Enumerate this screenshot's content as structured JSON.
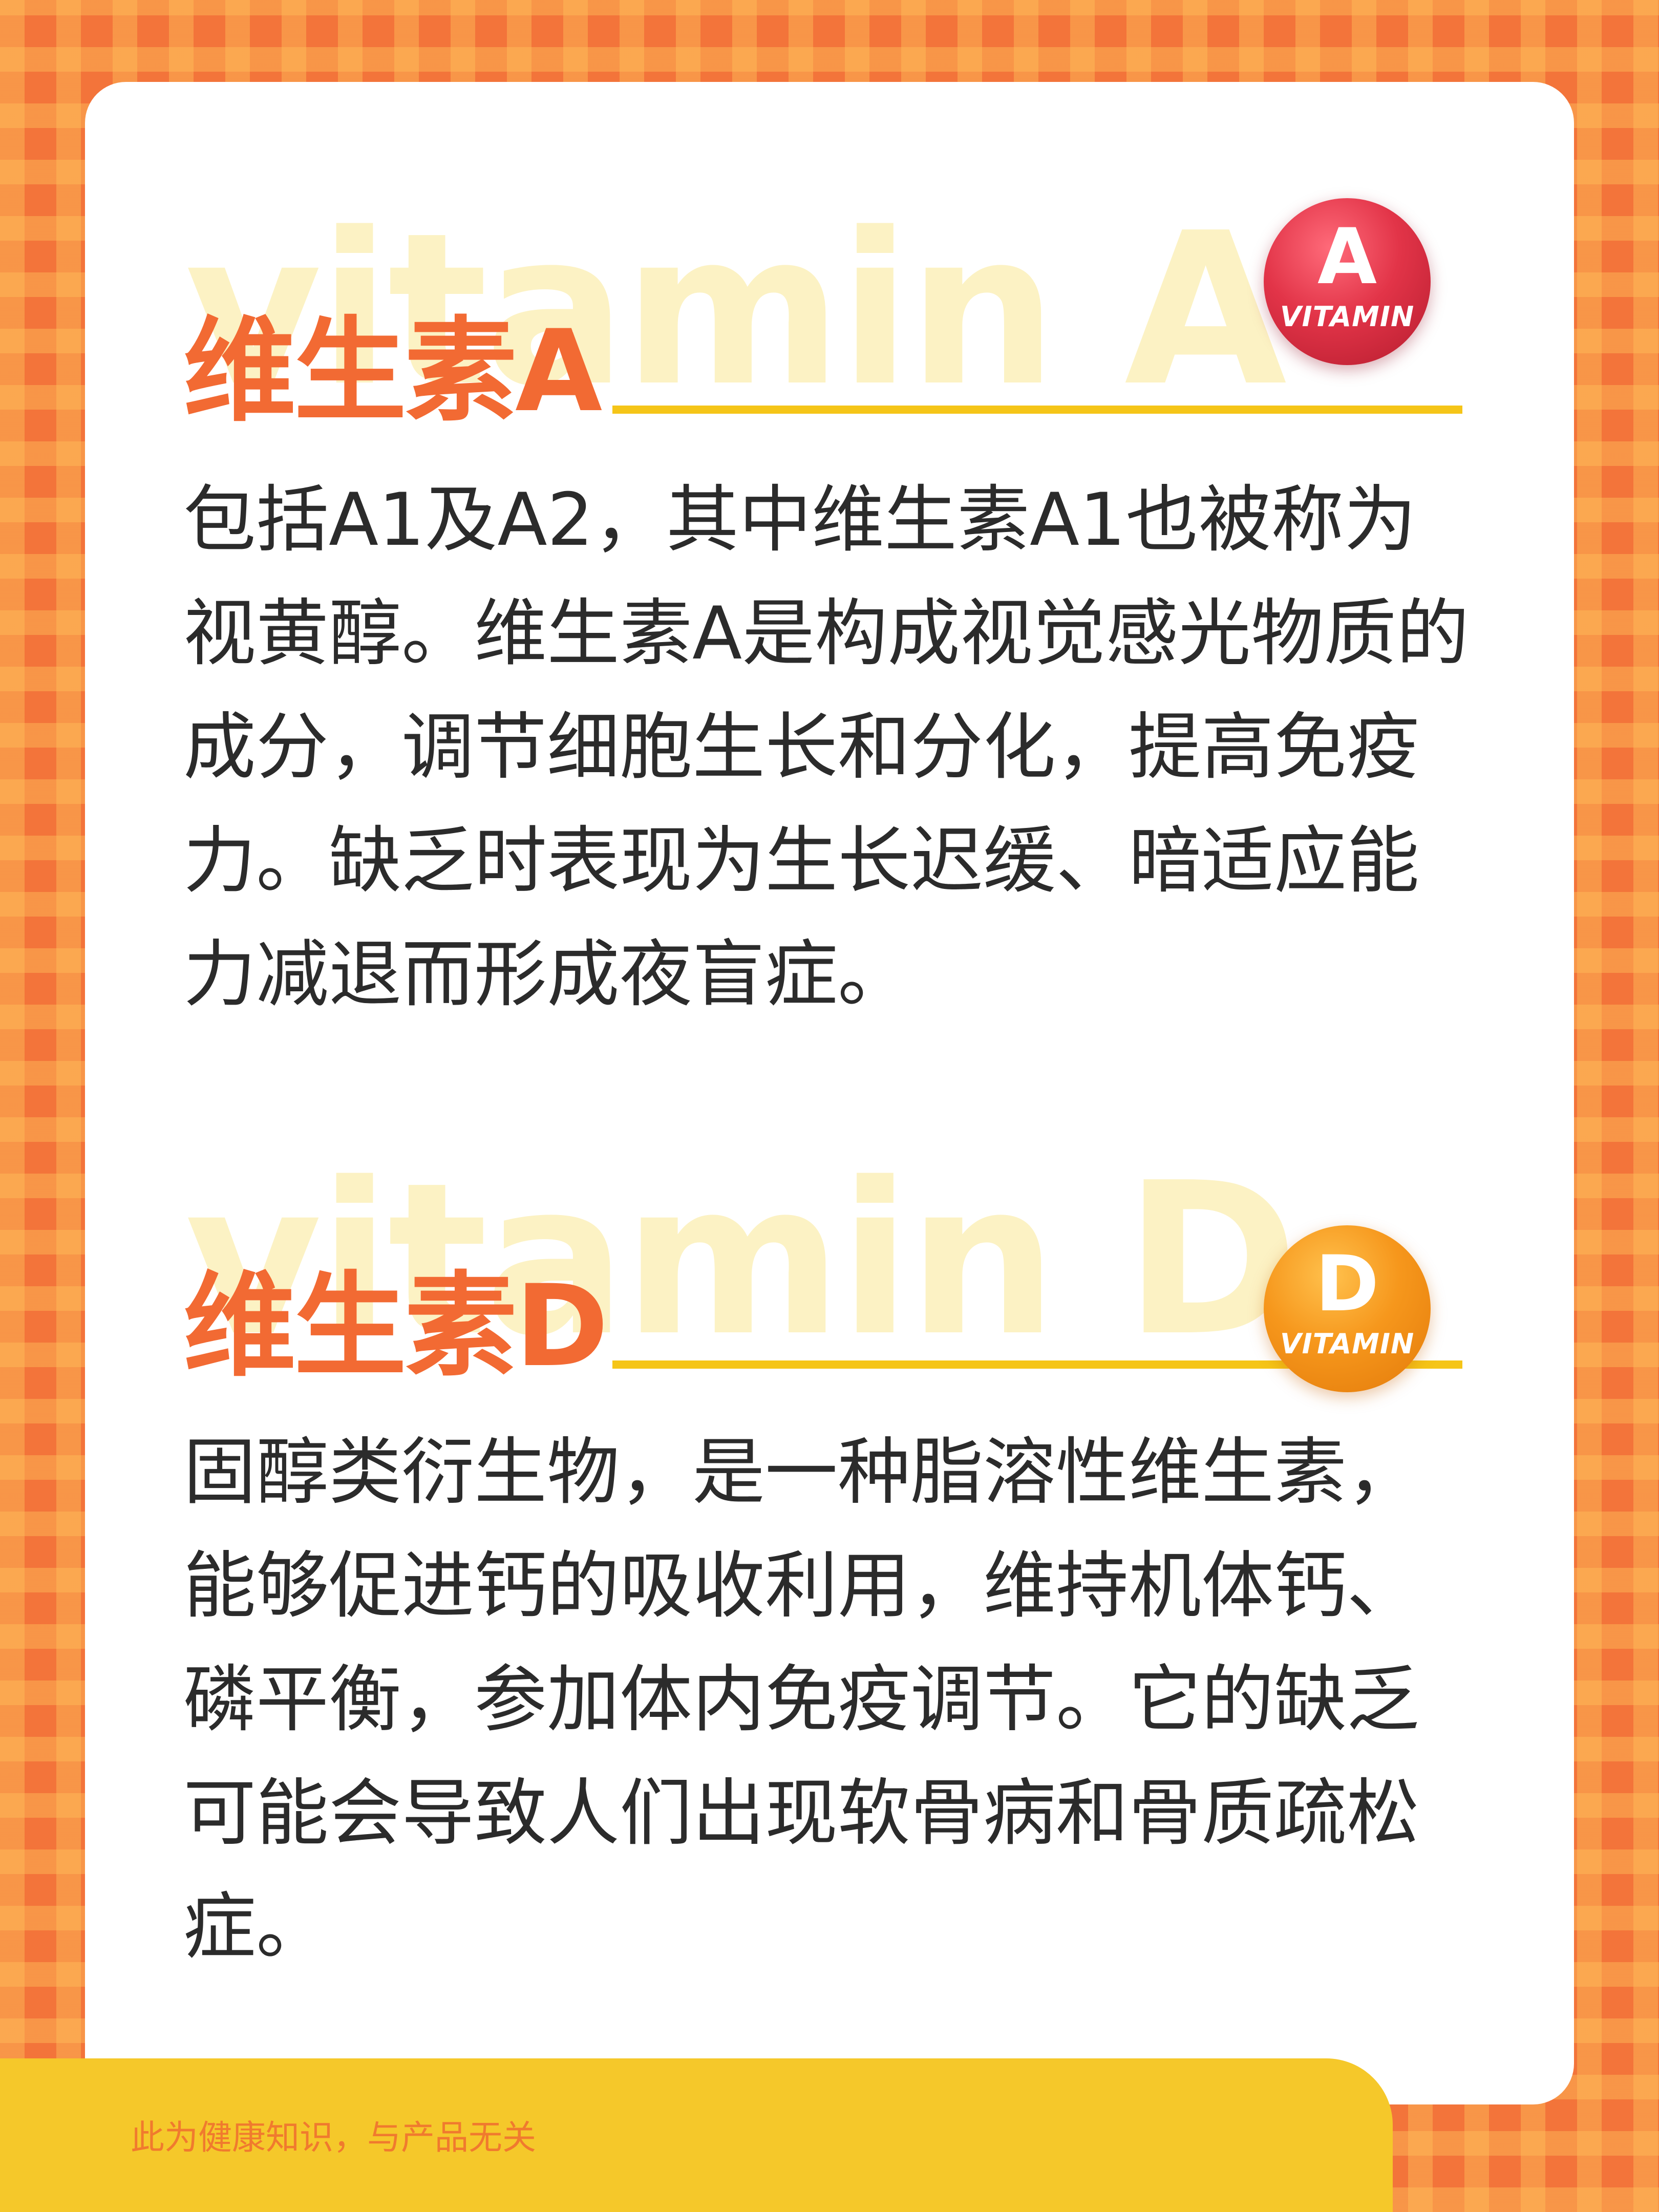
{
  "section_a": {
    "watermark": "vitamin A",
    "heading": "维生素A",
    "badge_letter": "A",
    "badge_word": "VITAMIN",
    "body": "包括A1及A2，其中维生素A1也被称为视黄醇。维生素A是构成视觉感光物质的成分，调节细胞生长和分化，提高免疫力。缺乏时表现为生长迟缓、暗适应能力减退而形成夜盲症。"
  },
  "section_d": {
    "watermark": "vitamin D",
    "heading": "维生素D",
    "badge_letter": "D",
    "badge_word": "VITAMIN",
    "body": "固醇类衍生物，是一种脂溶性维生素，能够促进钙的吸收利用，维持机体钙、磷平衡，参加体内免疫调节。它的缺乏可能会导致人们出现软骨病和骨质疏松症。"
  },
  "footer": {
    "disclaimer": "此为健康知识，与产品无关"
  },
  "colors": {
    "background": "#f3743a",
    "heading": "#f26a33",
    "accent_rule": "#f5c518",
    "watermark": "#fcf2c4",
    "badge_a": "#e23448",
    "badge_d": "#f6971c",
    "footer_bar": "#f5c82a"
  }
}
